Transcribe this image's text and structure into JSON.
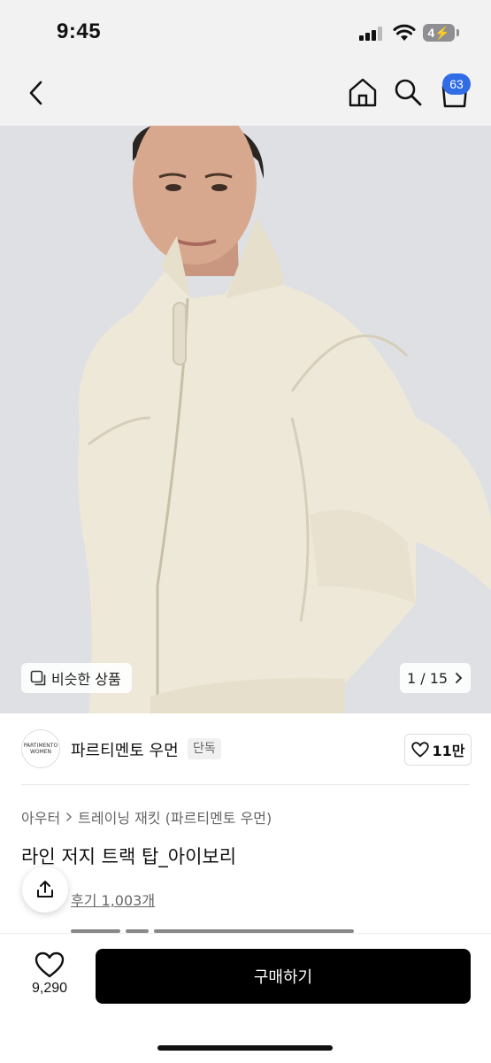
{
  "status_bar": {
    "time": "9:45",
    "battery": "4"
  },
  "nav": {
    "cart_count": "63"
  },
  "image": {
    "similar_label": "비슷한 상품",
    "page_current": "1",
    "page_sep": "/",
    "page_total": "15"
  },
  "brand": {
    "logo_line1": "PARTIMENTO",
    "logo_line2": "WOMEN",
    "name": "파르티멘토 우먼",
    "tag": "단독",
    "likes": "11만"
  },
  "product": {
    "breadcrumb": [
      "아우터",
      "트레이닝 재킷 (파르티멘토 우먼)"
    ],
    "title": "라인 저지 트랙 탑_아이보리",
    "reviews": "후기 1,003개"
  },
  "bottom": {
    "heart_count": "9,290",
    "buy_label": "구매하기"
  },
  "colors": {
    "accent": "#2f6ce5",
    "buy_button": "#000000",
    "jacket": "#eee8d8"
  }
}
